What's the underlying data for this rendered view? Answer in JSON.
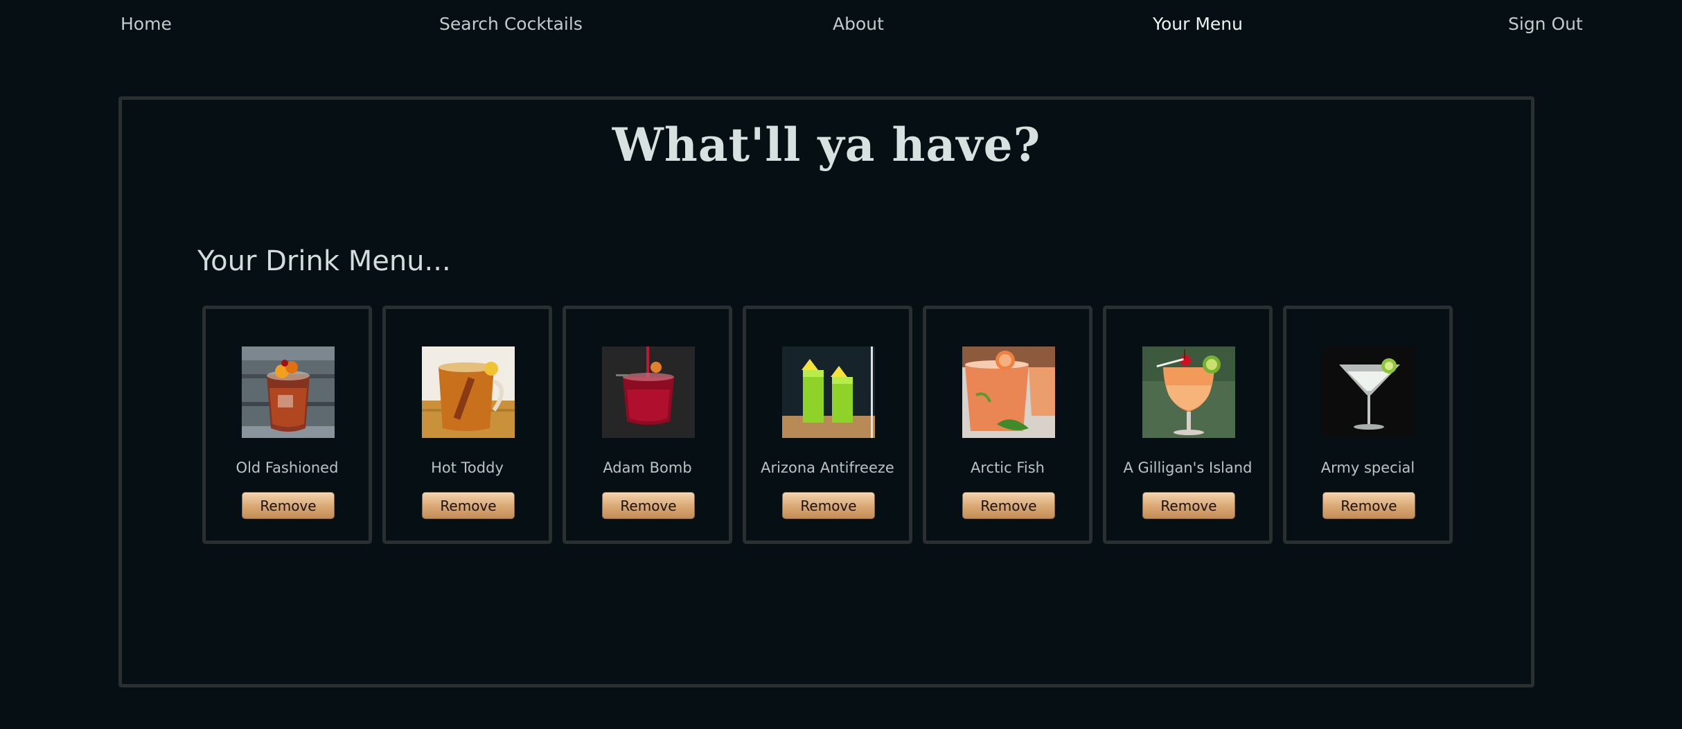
{
  "nav": {
    "home": "Home",
    "search": "Search Cocktails",
    "about": "About",
    "menu": "Your Menu",
    "signout": "Sign Out"
  },
  "headline": "What'll ya have?",
  "subhead": "Your Drink Menu...",
  "drinks": [
    {
      "name": "Old Fashioned",
      "remove_label": "Remove"
    },
    {
      "name": "Hot Toddy",
      "remove_label": "Remove"
    },
    {
      "name": "Adam Bomb",
      "remove_label": "Remove"
    },
    {
      "name": "Arizona Antifreeze",
      "remove_label": "Remove"
    },
    {
      "name": "Arctic Fish",
      "remove_label": "Remove"
    },
    {
      "name": "A Gilligan's Island",
      "remove_label": "Remove"
    },
    {
      "name": "Army special",
      "remove_label": "Remove"
    }
  ],
  "colors": {
    "background": "#061014",
    "border": "#2a2f30",
    "button": "#d9a772"
  }
}
